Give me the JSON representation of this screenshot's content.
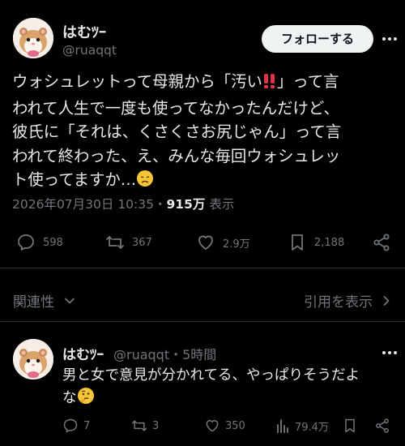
{
  "tweet": {
    "author_name": "はむﾂｰ",
    "author_handle": "@ruaqqt",
    "follow_label": "フォローする",
    "text_line1": "ウォシュレットって母親から「汚い",
    "text_line1_end": "」って言",
    "text_line2": "われて人生で一度も使ってなかったんだけど、",
    "text_line3": "彼氏に「それは、くさくさお尻じゃん」って言",
    "text_line4": "われて終わった、え、みんな毎回ウォシュレッ",
    "text_line5": "ト使ってますか…",
    "timestamp": "2026年07月30日 10:35",
    "separator": "・",
    "views_count": "915万",
    "views_label": "表示",
    "replies": "598",
    "reposts": "367",
    "likes": "2.9万",
    "bookmarks": "2,188"
  },
  "replies_section": {
    "sort_label": "関連性",
    "quotes_label": "引用を表示"
  },
  "reply": {
    "author_name": "はむﾂｰ",
    "author_handle": "@ruaqqt",
    "time": "・5時間",
    "text_line1": "男と女で意見が分かれてる、やっぱりそうだよ",
    "text_line2": "な",
    "replies": "7",
    "reposts": "3",
    "likes": "350",
    "views": "79.4万"
  }
}
